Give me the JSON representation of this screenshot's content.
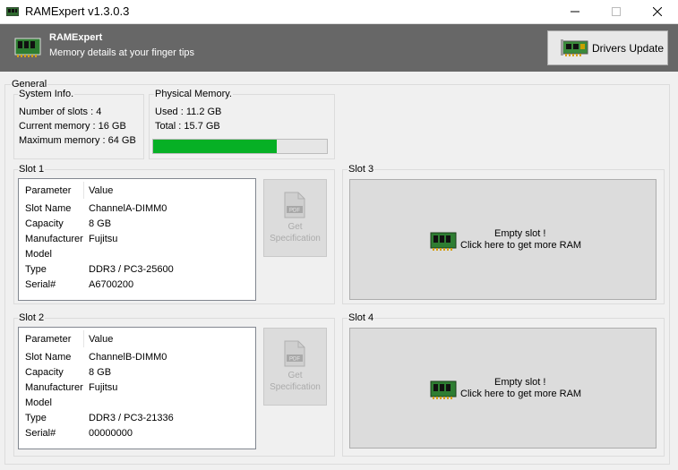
{
  "window": {
    "title": "RAMExpert v1.3.0.3"
  },
  "header": {
    "brand": "RAMExpert",
    "tagline": "Memory details at your finger tips",
    "drivers_update_label": "Drivers Update"
  },
  "general": {
    "label": "General",
    "system_info": {
      "label": "System Info.",
      "slots": "Number of slots : 4",
      "current": "Current memory : 16 GB",
      "maximum": "Maximum memory : 64 GB"
    },
    "physical_memory": {
      "label": "Physical Memory.",
      "used": "Used : 11.2 GB",
      "total": "Total : 15.7 GB",
      "usage_fraction": 0.71,
      "bar_color": "#06b025"
    }
  },
  "table_headers": {
    "parameter": "Parameter",
    "value": "Value"
  },
  "spec_button": {
    "line1": "Get",
    "line2": "Specification",
    "icon": "pdf-file-icon"
  },
  "slots": [
    {
      "label": "Slot 1",
      "rows": [
        {
          "param": "Slot Name",
          "value": "ChannelA-DIMM0"
        },
        {
          "param": "Capacity",
          "value": "8 GB"
        },
        {
          "param": "Manufacturer",
          "value": "Fujitsu"
        },
        {
          "param": "Model",
          "value": ""
        },
        {
          "param": "Type",
          "value": "DDR3 / PC3-25600"
        },
        {
          "param": "Serial#",
          "value": "A6700200"
        }
      ]
    },
    {
      "label": "Slot 2",
      "rows": [
        {
          "param": "Slot Name",
          "value": "ChannelB-DIMM0"
        },
        {
          "param": "Capacity",
          "value": "8 GB"
        },
        {
          "param": "Manufacturer",
          "value": "Fujitsu"
        },
        {
          "param": "Model",
          "value": ""
        },
        {
          "param": "Type",
          "value": "DDR3 / PC3-21336"
        },
        {
          "param": "Serial#",
          "value": "00000000"
        }
      ]
    },
    {
      "label": "Slot 3",
      "empty_line1": "Empty slot !",
      "empty_line2": "Click here to get more RAM"
    },
    {
      "label": "Slot 4",
      "empty_line1": "Empty slot !",
      "empty_line2": "Click here to get more RAM"
    }
  ]
}
